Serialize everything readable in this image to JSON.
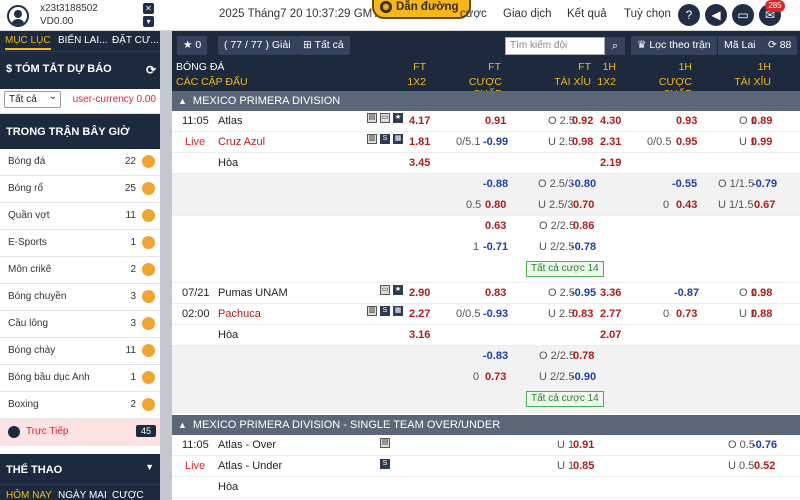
{
  "account": {
    "id": "x23t3188502",
    "balance": "VD0.00"
  },
  "clock": "2025 Tháng7 20 10:37:29 GMT +8",
  "guide_button": "Dẫn đường",
  "top_nav": [
    "cược",
    "Giao dịch",
    "Kết quả",
    "Tuỳ chọn"
  ],
  "notification_count": "285",
  "sidebar": {
    "tabs": [
      "MỤC LỤC",
      "BIỂN LAI...",
      "ĐẶT CƯ..."
    ],
    "summary_title": "TÓM TẮT DỰ BÁO",
    "filter_value": "Tất cả",
    "currency_label": "user-currency 0.00",
    "section_title": "TRONG TRẬN BÂY GIỜ",
    "items": [
      {
        "name": "Bóng đá",
        "count": "22",
        "color": "#f0a431"
      },
      {
        "name": "Bóng rổ",
        "count": "25",
        "color": "#f0a431"
      },
      {
        "name": "Quần vợt",
        "count": "11",
        "color": "#f0a431"
      },
      {
        "name": "E-Sports",
        "count": "1",
        "color": "#f0a431"
      },
      {
        "name": "Môn crikê",
        "count": "2",
        "color": "#f0a431"
      },
      {
        "name": "Bóng chuyền",
        "count": "3",
        "color": "#f0a431"
      },
      {
        "name": "Cầu lông",
        "count": "3",
        "color": "#f0a431"
      },
      {
        "name": "Bóng chày",
        "count": "11",
        "color": "#f0a431"
      },
      {
        "name": "Bóng bầu dục Anh",
        "count": "1",
        "color": "#f0a431"
      },
      {
        "name": "Boxing",
        "count": "2",
        "color": "#f0a431"
      }
    ],
    "live_label": "Trực Tiếp",
    "live_count": "45",
    "sports_title": "THỂ THAO",
    "bottom_tabs": [
      "HÔM NAY",
      "NGÀY MAI",
      "CƯỢC H..."
    ]
  },
  "toolbar": {
    "star_count": "0",
    "games_label": "( 77 / 77 ) Giải",
    "all_label": "Tất cả",
    "search_placeholder": "Tìm kiếm đội",
    "filter_label": "Lọc theo trận",
    "malai_label": "Mã Lai",
    "refresh_count": "88"
  },
  "headers": {
    "sport": "BÓNG ĐÁ",
    "all_matches": "CÁC CẶP ĐẤU",
    "ft_1x2_top": "FT",
    "ft_1x2_bot": "1X2",
    "ft_hdp_top": "FT",
    "ft_hdp_bot": "CƯỢC CHẤP",
    "ft_ou_top": "FT",
    "ft_ou_bot": "TÀI XỈU",
    "h1_1x2_top": "1H",
    "h1_1x2_bot": "1X2",
    "h1_hdp_top": "1H",
    "h1_hdp_bot": "CƯỢC CHẤP",
    "h1_ou_top": "1H",
    "h1_ou_bot": "TÀI XỈU"
  },
  "league1": "MEXICO PRIMERA DIVISION",
  "m1": {
    "time": "11:05",
    "status": "Live",
    "home": "Atlas",
    "away": "Cruz Azul",
    "draw": "Hòa",
    "ft1x2": [
      "4.17",
      "1.81",
      "3.45"
    ],
    "fthdp_h": "0.91",
    "fthdp_line": "0/5.1",
    "fthdp_a": "-0.99",
    "ftou_o_lbl": "O 2.5",
    "ftou_o": "0.92",
    "ftou_u_lbl": "U 2.5",
    "ftou_u": "0.98",
    "h1x2": [
      "4.30",
      "2.31",
      "2.19"
    ],
    "h1hdp_h": "0.93",
    "h1hdp_line": "0/0.5",
    "h1hdp_a": "0.95",
    "h1ou_o_lbl": "O 1",
    "h1ou_o": "0.89",
    "h1ou_u_lbl": "U 1",
    "h1ou_u": "0.99",
    "x1_hdp_h": "-0.88",
    "x1_ou_o_lbl": "O 2.5/3",
    "x1_ou_o": "-0.80",
    "x1_h1hdp_h": "-0.55",
    "x1_h1ou_o_lbl": "O 1/1.5",
    "x1_h1ou_o": "-0.79",
    "x2_hdp_line": "0.5",
    "x2_hdp_a": "0.80",
    "x2_ou_u_lbl": "U 2.5/3",
    "x2_ou_u": "0.70",
    "x2_h1hdp_line": "0",
    "x2_h1hdp_a": "0.43",
    "x2_h1ou_u_lbl": "U 1/1.5",
    "x2_h1ou_u": "0.67",
    "x3_hdp_h": "0.63",
    "x3_ou_o_lbl": "O 2/2.5",
    "x3_ou_o": "0.86",
    "x4_hdp_line": "1",
    "x4_hdp_a": "-0.71",
    "x4_ou_u_lbl": "U 2/2.5",
    "x4_ou_u": "-0.78",
    "allbets": "Tất cả cược 14"
  },
  "m2": {
    "date": "07/21",
    "time": "02:00",
    "home": "Pumas UNAM",
    "away": "Pachuca",
    "draw": "Hòa",
    "ft1x2": [
      "2.90",
      "2.27",
      "3.16"
    ],
    "fthdp_h": "0.83",
    "fthdp_line": "0/0.5",
    "fthdp_a": "-0.93",
    "ftou_o_lbl": "O 2.5",
    "ftou_o": "-0.95",
    "ftou_u_lbl": "U 2.5",
    "ftou_u": "0.83",
    "h1x2": [
      "3.36",
      "2.77",
      "2.07"
    ],
    "h1hdp_h": "-0.87",
    "h1hdp_line": "0",
    "h1hdp_a": "0.73",
    "h1ou_o_lbl": "O 1",
    "h1ou_o": "0.98",
    "h1ou_u_lbl": "U 1",
    "h1ou_u": "0.88",
    "x1_hdp_h": "-0.83",
    "x1_ou_o_lbl": "O 2/2.5",
    "x1_ou_o": "0.78",
    "x2_hdp_line": "0",
    "x2_hdp_a": "0.73",
    "x2_ou_u_lbl": "U 2/2.5",
    "x2_ou_u": "-0.90",
    "allbets": "Tất cả cược 14"
  },
  "league2": "MEXICO PRIMERA DIVISION - SINGLE TEAM OVER/UNDER",
  "m3": {
    "time": "11:05",
    "status": "Live",
    "home": "Atlas - Over",
    "away": "Atlas - Under",
    "draw": "Hòa",
    "ftou_o_lbl": "U 1",
    "ftou_o": "0.91",
    "ftou_u_lbl": "U 1",
    "ftou_u": "0.85",
    "h1ou_o_lbl": "O 0.5",
    "h1ou_o": "-0.76",
    "h1ou_u_lbl": "U 0.5",
    "h1ou_u": "0.52"
  }
}
